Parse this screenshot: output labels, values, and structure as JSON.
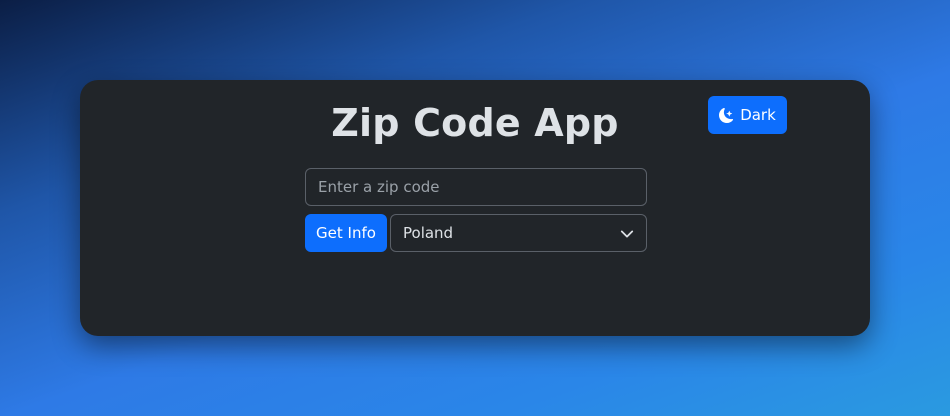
{
  "app": {
    "title": "Zip Code App"
  },
  "theme_toggle": {
    "label": "Dark",
    "icon": "moon-stars-icon"
  },
  "zip_input": {
    "value": "",
    "placeholder": "Enter a zip code"
  },
  "get_info_button": {
    "label": "Get Info"
  },
  "country_select": {
    "selected": "Poland"
  },
  "colors": {
    "accent": "#0d6efd",
    "card_background": "#212529",
    "text": "#dee2e6"
  }
}
